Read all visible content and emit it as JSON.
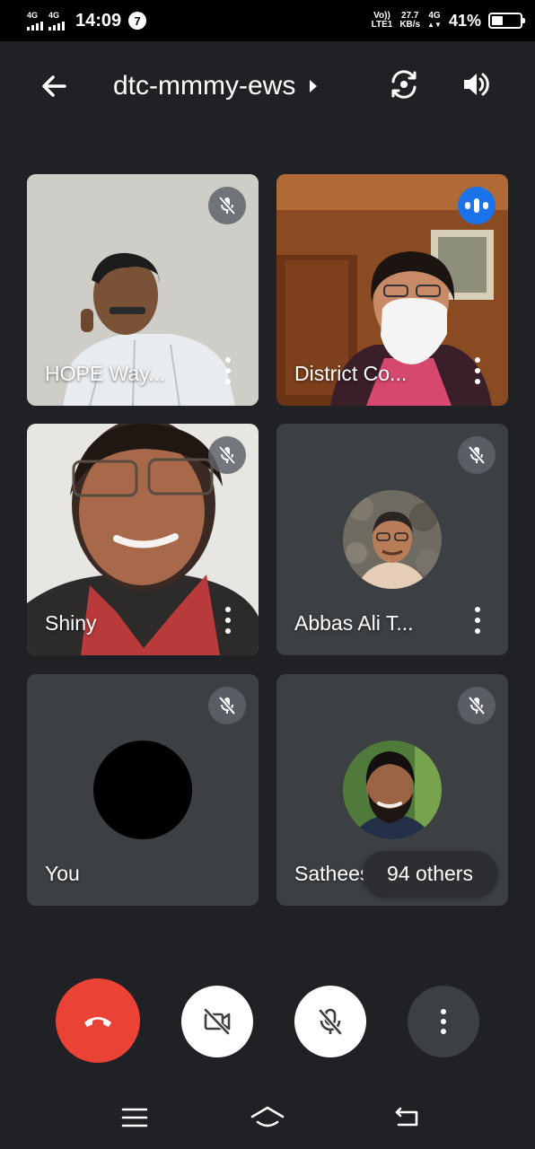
{
  "status_bar": {
    "sim1": "4G",
    "sim2": "4G",
    "time": "14:09",
    "notification_count": "7",
    "volte_top": "Vo))",
    "volte_bottom": "LTE1",
    "speed_value": "27.7",
    "speed_unit": "KB/s",
    "network_type": "4G",
    "battery_percent": "41%",
    "battery_level": 0.41
  },
  "header": {
    "meeting_code": "dtc-mmmy-ews"
  },
  "participants": [
    {
      "name": "HOPE Way...",
      "muted": true,
      "speaking": false
    },
    {
      "name": "District Co...",
      "muted": false,
      "speaking": true
    },
    {
      "name": "Shiny",
      "muted": true,
      "speaking": false
    },
    {
      "name": "Abbas Ali T...",
      "muted": true,
      "speaking": false
    },
    {
      "name": "You",
      "muted": true,
      "speaking": false
    },
    {
      "name": "Sathees",
      "muted": true,
      "speaking": false
    }
  ],
  "others_label": "94 others",
  "colors": {
    "background": "#202124",
    "tile": "#3c4043",
    "end_call": "#ea4335",
    "speaking": "#1a73e8"
  },
  "icons": {
    "back": "arrow-left-icon",
    "switch_camera": "switch-camera-icon",
    "speaker": "speaker-icon",
    "mic_off": "mic-off-icon",
    "cam_off": "video-off-icon",
    "end_call": "phone-hangup-icon",
    "more": "more-vert-icon"
  }
}
